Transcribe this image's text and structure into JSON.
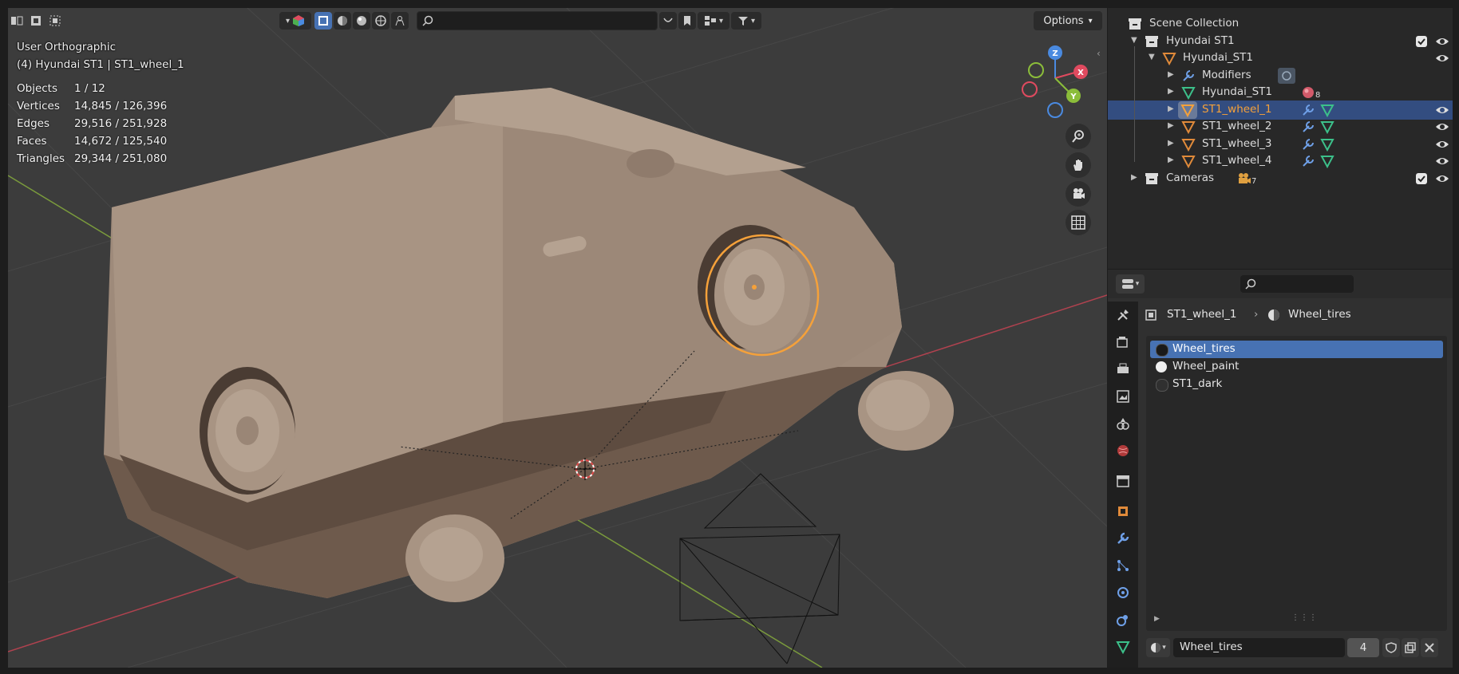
{
  "viewport": {
    "view_name": "User Orthographic",
    "context": "(4) Hyundai ST1 | ST1_wheel_1",
    "stats": [
      {
        "label": "Objects",
        "value": "1 / 12"
      },
      {
        "label": "Vertices",
        "value": "14,845 / 126,396"
      },
      {
        "label": "Edges",
        "value": "29,516 / 251,928"
      },
      {
        "label": "Faces",
        "value": "14,672 / 125,540"
      },
      {
        "label": "Triangles",
        "value": "29,344 / 251,080"
      }
    ],
    "options_label": "Options",
    "search_placeholder": "",
    "gizmo": {
      "x": "X",
      "y": "Y",
      "z": "Z"
    }
  },
  "outliner": {
    "root": "Scene Collection",
    "rows": [
      {
        "label": "Hyundai ST1"
      },
      {
        "label": "Hyundai_ST1"
      },
      {
        "label": "Modifiers"
      },
      {
        "label": "Hyundai_ST1",
        "badge": "8"
      },
      {
        "label": "ST1_wheel_1"
      },
      {
        "label": "ST1_wheel_2"
      },
      {
        "label": "ST1_wheel_3"
      },
      {
        "label": "ST1_wheel_4"
      },
      {
        "label": "Cameras",
        "badge": "7"
      }
    ]
  },
  "properties": {
    "search_placeholder": "",
    "breadcrumb": {
      "object": "ST1_wheel_1",
      "material": "Wheel_tires"
    },
    "material_slots": [
      {
        "name": "Wheel_tires",
        "color": "#1a1a1a"
      },
      {
        "name": "Wheel_paint",
        "color": "#f0f0f0"
      },
      {
        "name": "ST1_dark",
        "color": "#303030"
      }
    ],
    "active_material": "Wheel_tires",
    "user_count": "4"
  },
  "colors": {
    "accent": "#4772b3",
    "selected_row": "#334d80",
    "selection_outline": "#f5a13a",
    "axis_x": "#e04a5f",
    "axis_y": "#8bbd3a",
    "axis_z": "#4a8ae0"
  }
}
